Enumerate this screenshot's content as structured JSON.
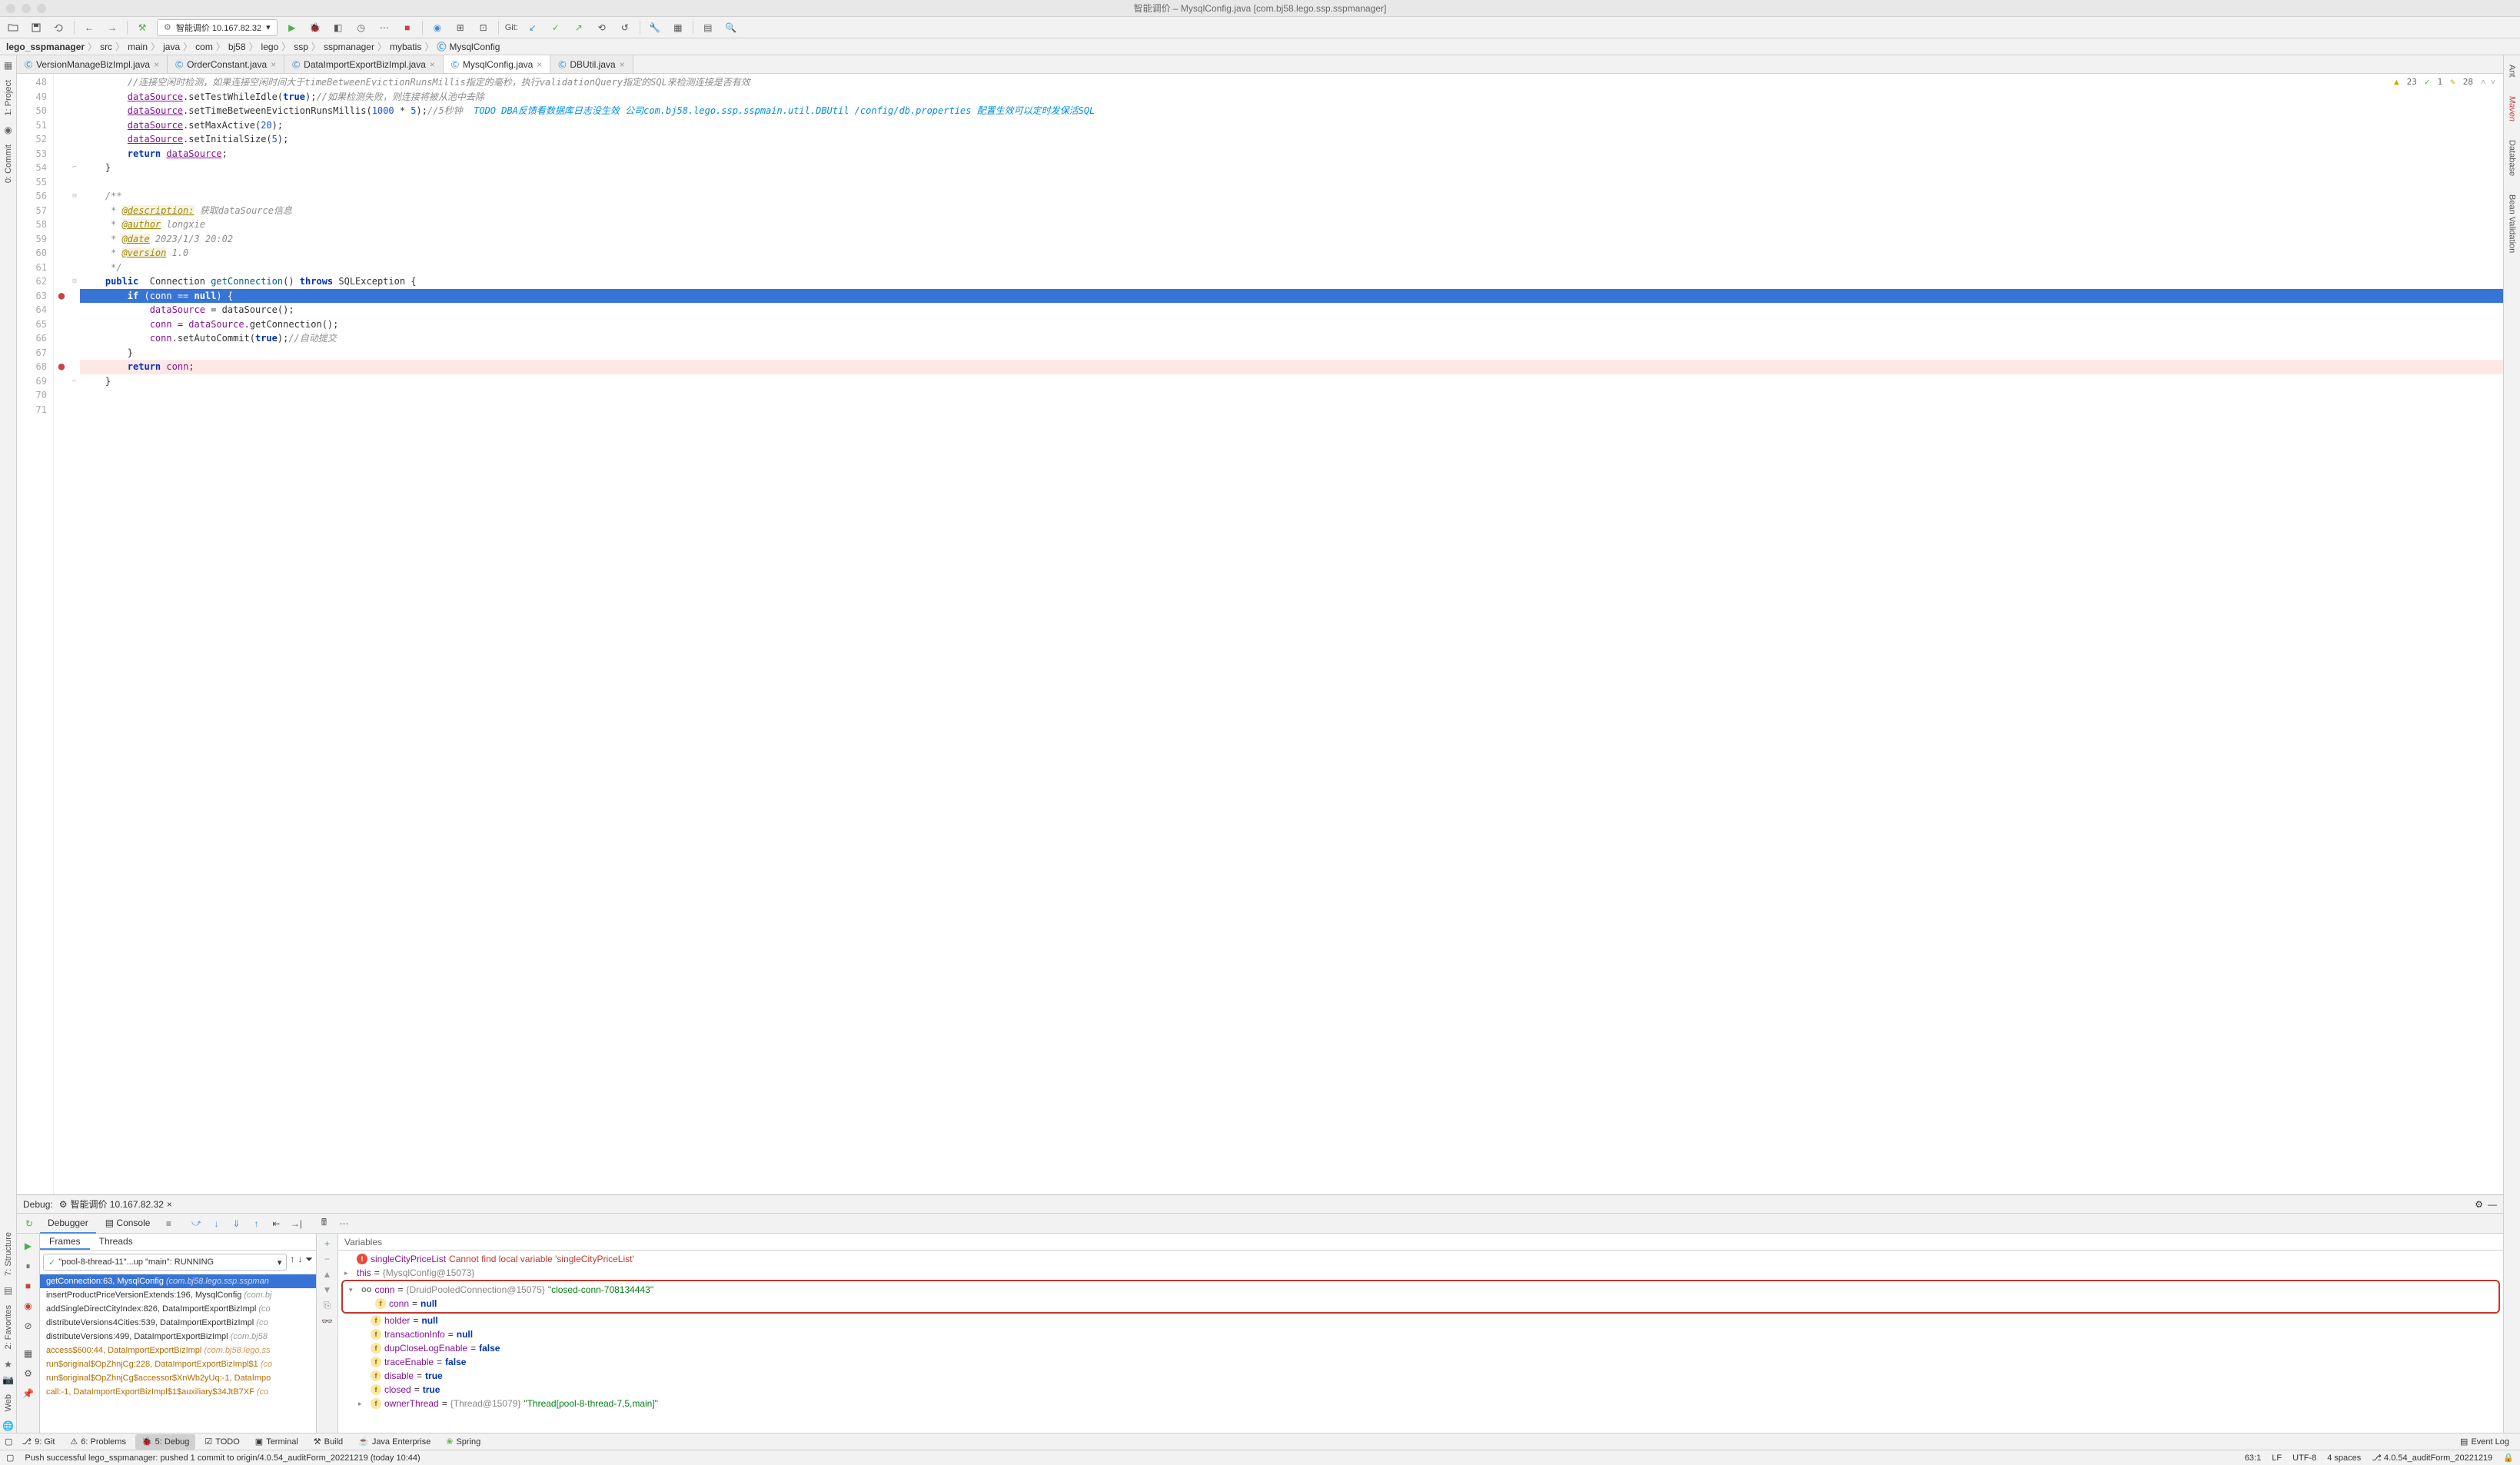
{
  "titlebar": {
    "title": "智能调价 – MysqlConfig.java [com.bj58.lego.ssp.sspmanager]"
  },
  "toolbar": {
    "run_config": "智能调价 10.167.82.32",
    "git_label": "Git:"
  },
  "breadcrumb": {
    "items": [
      "lego_sspmanager",
      "src",
      "main",
      "java",
      "com",
      "bj58",
      "lego",
      "ssp",
      "sspmanager",
      "mybatis",
      "MysqlConfig"
    ]
  },
  "left_tools": {
    "project": "1: Project",
    "commit": "0: Commit",
    "structure": "7: Structure",
    "favorites": "2: Favorites",
    "web": "Web"
  },
  "right_tools": {
    "ant": "Ant",
    "maven": "Maven",
    "database": "Database",
    "bean": "Bean Validation"
  },
  "editor_tabs": [
    {
      "label": "VersionManageBizImpl.java",
      "active": false
    },
    {
      "label": "OrderConstant.java",
      "active": false
    },
    {
      "label": "DataImportExportBizImpl.java",
      "active": false
    },
    {
      "label": "MysqlConfig.java",
      "active": true
    },
    {
      "label": "DBUtil.java",
      "active": false
    }
  ],
  "editor": {
    "warnings": "23",
    "checks": "1",
    "hints": "28",
    "lines": [
      {
        "n": 48,
        "html": "        <span class='cmt'>//连接空闲时检测，如果连接空闲时间大于timeBetweenEvictionRunsMillis指定的毫秒，执行validationQuery指定的SQL来检测连接是否有效</span>"
      },
      {
        "n": 49,
        "html": "        <span class='field u'>dataSource</span>.setTestWhileIdle(<span class='kw'>true</span>);<span class='cmt'>//如果检测失败，则连接将被从池中去除</span>"
      },
      {
        "n": 50,
        "html": "        <span class='field u'>dataSource</span>.setTimeBetweenEvictionRunsMillis(<span class='num'>1000</span> * <span class='num'>5</span>);<span class='cmt'>//5秒钟</span>  <span class='cmt-todo'>TODO DBA反馈看数据库日志没生效 公司com.bj58.lego.ssp.sspmain.util.DBUtil /config/db.properties 配置生效可以定时发保活SQL</span>"
      },
      {
        "n": 51,
        "html": "        <span class='field u'>dataSource</span>.setMaxActive(<span class='num'>20</span>);"
      },
      {
        "n": 52,
        "html": "        <span class='field u'>dataSource</span>.setInitialSize(<span class='num'>5</span>);"
      },
      {
        "n": 53,
        "html": "        <span class='kw'>return</span> <span class='field u'>dataSource</span>;"
      },
      {
        "n": 54,
        "html": "    }",
        "foldEnd": true
      },
      {
        "n": 55,
        "html": ""
      },
      {
        "n": 56,
        "html": "    <span class='cmt'>/**</span>",
        "foldStart": true
      },
      {
        "n": 57,
        "html": "     <span class='cmt'>* <span class='ann u'>@description:</span> 获取dataSource信息</span>"
      },
      {
        "n": 58,
        "html": "     <span class='cmt'>* <span class='ann u'>@author</span> longxie</span>"
      },
      {
        "n": 59,
        "html": "     <span class='cmt'>* <span class='ann u'>@date</span> 2023/1/3 20:02</span>"
      },
      {
        "n": 60,
        "html": "     <span class='cmt'>* <span class='ann u'>@version</span> 1.0</span>"
      },
      {
        "n": 61,
        "html": "     <span class='cmt'>*/</span>"
      },
      {
        "n": 62,
        "html": "    <span class='kw'>public</span>  Connection <span class='method'>getConnection</span>() <span class='kw'>throws</span> SQLException {",
        "foldStart": true
      },
      {
        "n": 63,
        "hl": true,
        "bp": true,
        "html": "        <span class='kw'>if</span> (<span class='field'>conn</span> == <span class='kw'>null</span>) {"
      },
      {
        "n": 64,
        "html": "            <span class='field'>dataSource</span> = dataSource();"
      },
      {
        "n": 65,
        "html": "            <span class='field'>conn</span> = <span class='field'>dataSource</span>.getConnection();"
      },
      {
        "n": 66,
        "html": "            <span class='field'>conn</span>.setAutoCommit(<span class='kw'>true</span>);<span class='cmt'>//自动提交</span>"
      },
      {
        "n": 67,
        "html": "        }"
      },
      {
        "n": 68,
        "bp": true,
        "bpline": true,
        "html": "        <span class='kw'>return</span> <span class='field'>conn</span>;"
      },
      {
        "n": 69,
        "html": "    }",
        "foldEnd": true
      },
      {
        "n": 70,
        "html": ""
      },
      {
        "n": 71,
        "html": ""
      }
    ]
  },
  "debug": {
    "title": "Debug:",
    "config": "智能调价 10.167.82.32",
    "tabs": {
      "debugger": "Debugger",
      "console": "Console"
    },
    "frames_tabs": {
      "frames": "Frames",
      "threads": "Threads"
    },
    "thread": "\"pool-8-thread-11\"...up \"main\": RUNNING",
    "frames": [
      {
        "text": "getConnection:63, MysqlConfig",
        "pkg": "(com.bj58.lego.ssp.sspman",
        "selected": true
      },
      {
        "text": "insertProductPriceVersionExtends:196, MysqlConfig",
        "pkg": "(com.bj"
      },
      {
        "text": "addSingleDirectCityIndex:826, DataImportExportBizImpl",
        "pkg": "(co"
      },
      {
        "text": "distributeVersions4Cities:539, DataImportExportBizImpl",
        "pkg": "(co"
      },
      {
        "text": "distributeVersions:499, DataImportExportBizImpl",
        "pkg": "(com.bj58"
      },
      {
        "text": "access$600:44, DataImportExportBizImpl",
        "pkg": "(com.bj58.lego.ss",
        "lib": true
      },
      {
        "text": "run$original$OpZhnjCg:228, DataImportExportBizImpl$1",
        "pkg": "(co",
        "lib": true
      },
      {
        "text": "run$original$OpZhnjCg$accessor$XnWb2yUq:-1, DataImpo",
        "pkg": "",
        "lib": true
      },
      {
        "text": "call:-1, DataImportExportBizImpl$1$auxiliary$34JtB7XF",
        "pkg": "(co",
        "lib": true
      }
    ],
    "variables_label": "Variables",
    "variables": [
      {
        "indent": 0,
        "icon": "err",
        "name": "singleCityPriceList",
        "val": "Cannot find local variable 'singleCityPriceList'",
        "valClass": "err"
      },
      {
        "indent": 0,
        "arrow": "▸",
        "name": "this",
        "eq": "= ",
        "type": "{MysqlConfig@15073}",
        "cut": true
      },
      {
        "redbox_start": true
      },
      {
        "indent": 0,
        "arrow": "▾",
        "icon": "oo",
        "name": "conn",
        "eq": "= ",
        "type": "{DruidPooledConnection@15075}",
        "val": " \"closed-conn-708134443\"",
        "valClass": "str"
      },
      {
        "indent": 1,
        "icon": "f",
        "name": "conn",
        "eq": "= ",
        "val": "null",
        "valClass": "null",
        "cut": true
      },
      {
        "redbox_end": true
      },
      {
        "indent": 1,
        "icon": "f",
        "name": "holder",
        "eq": "= ",
        "val": "null",
        "valClass": "null"
      },
      {
        "indent": 1,
        "icon": "f",
        "name": "transactionInfo",
        "eq": "= ",
        "val": "null",
        "valClass": "null"
      },
      {
        "indent": 1,
        "icon": "f",
        "name": "dupCloseLogEnable",
        "eq": "= ",
        "val": "false",
        "valClass": "null"
      },
      {
        "indent": 1,
        "icon": "f",
        "name": "traceEnable",
        "eq": "= ",
        "val": "false",
        "valClass": "null"
      },
      {
        "indent": 1,
        "icon": "f",
        "name": "disable",
        "eq": "= ",
        "val": "true",
        "valClass": "null"
      },
      {
        "indent": 1,
        "icon": "f",
        "name": "closed",
        "eq": "= ",
        "val": "true",
        "valClass": "null"
      },
      {
        "indent": 1,
        "arrow": "▸",
        "icon": "f",
        "name": "ownerThread",
        "eq": "= ",
        "type": "{Thread@15079}",
        "val": " \"Thread[pool-8-thread-7,5,main]\"",
        "valClass": "str"
      }
    ]
  },
  "bottom_tools": {
    "git": "9: Git",
    "problems": "6: Problems",
    "debug": "5: Debug",
    "todo": "TODO",
    "terminal": "Terminal",
    "build": "Build",
    "java_ee": "Java Enterprise",
    "spring": "Spring",
    "event_log": "Event Log"
  },
  "statusbar": {
    "message": "Push successful lego_sspmanager: pushed 1 commit to origin/4.0.54_auditForm_20221219 (today 10:44)",
    "pos": "63:1",
    "eol": "LF",
    "encoding": "UTF-8",
    "indent": "4 spaces",
    "branch": "4.0.54_auditForm_20221219"
  }
}
